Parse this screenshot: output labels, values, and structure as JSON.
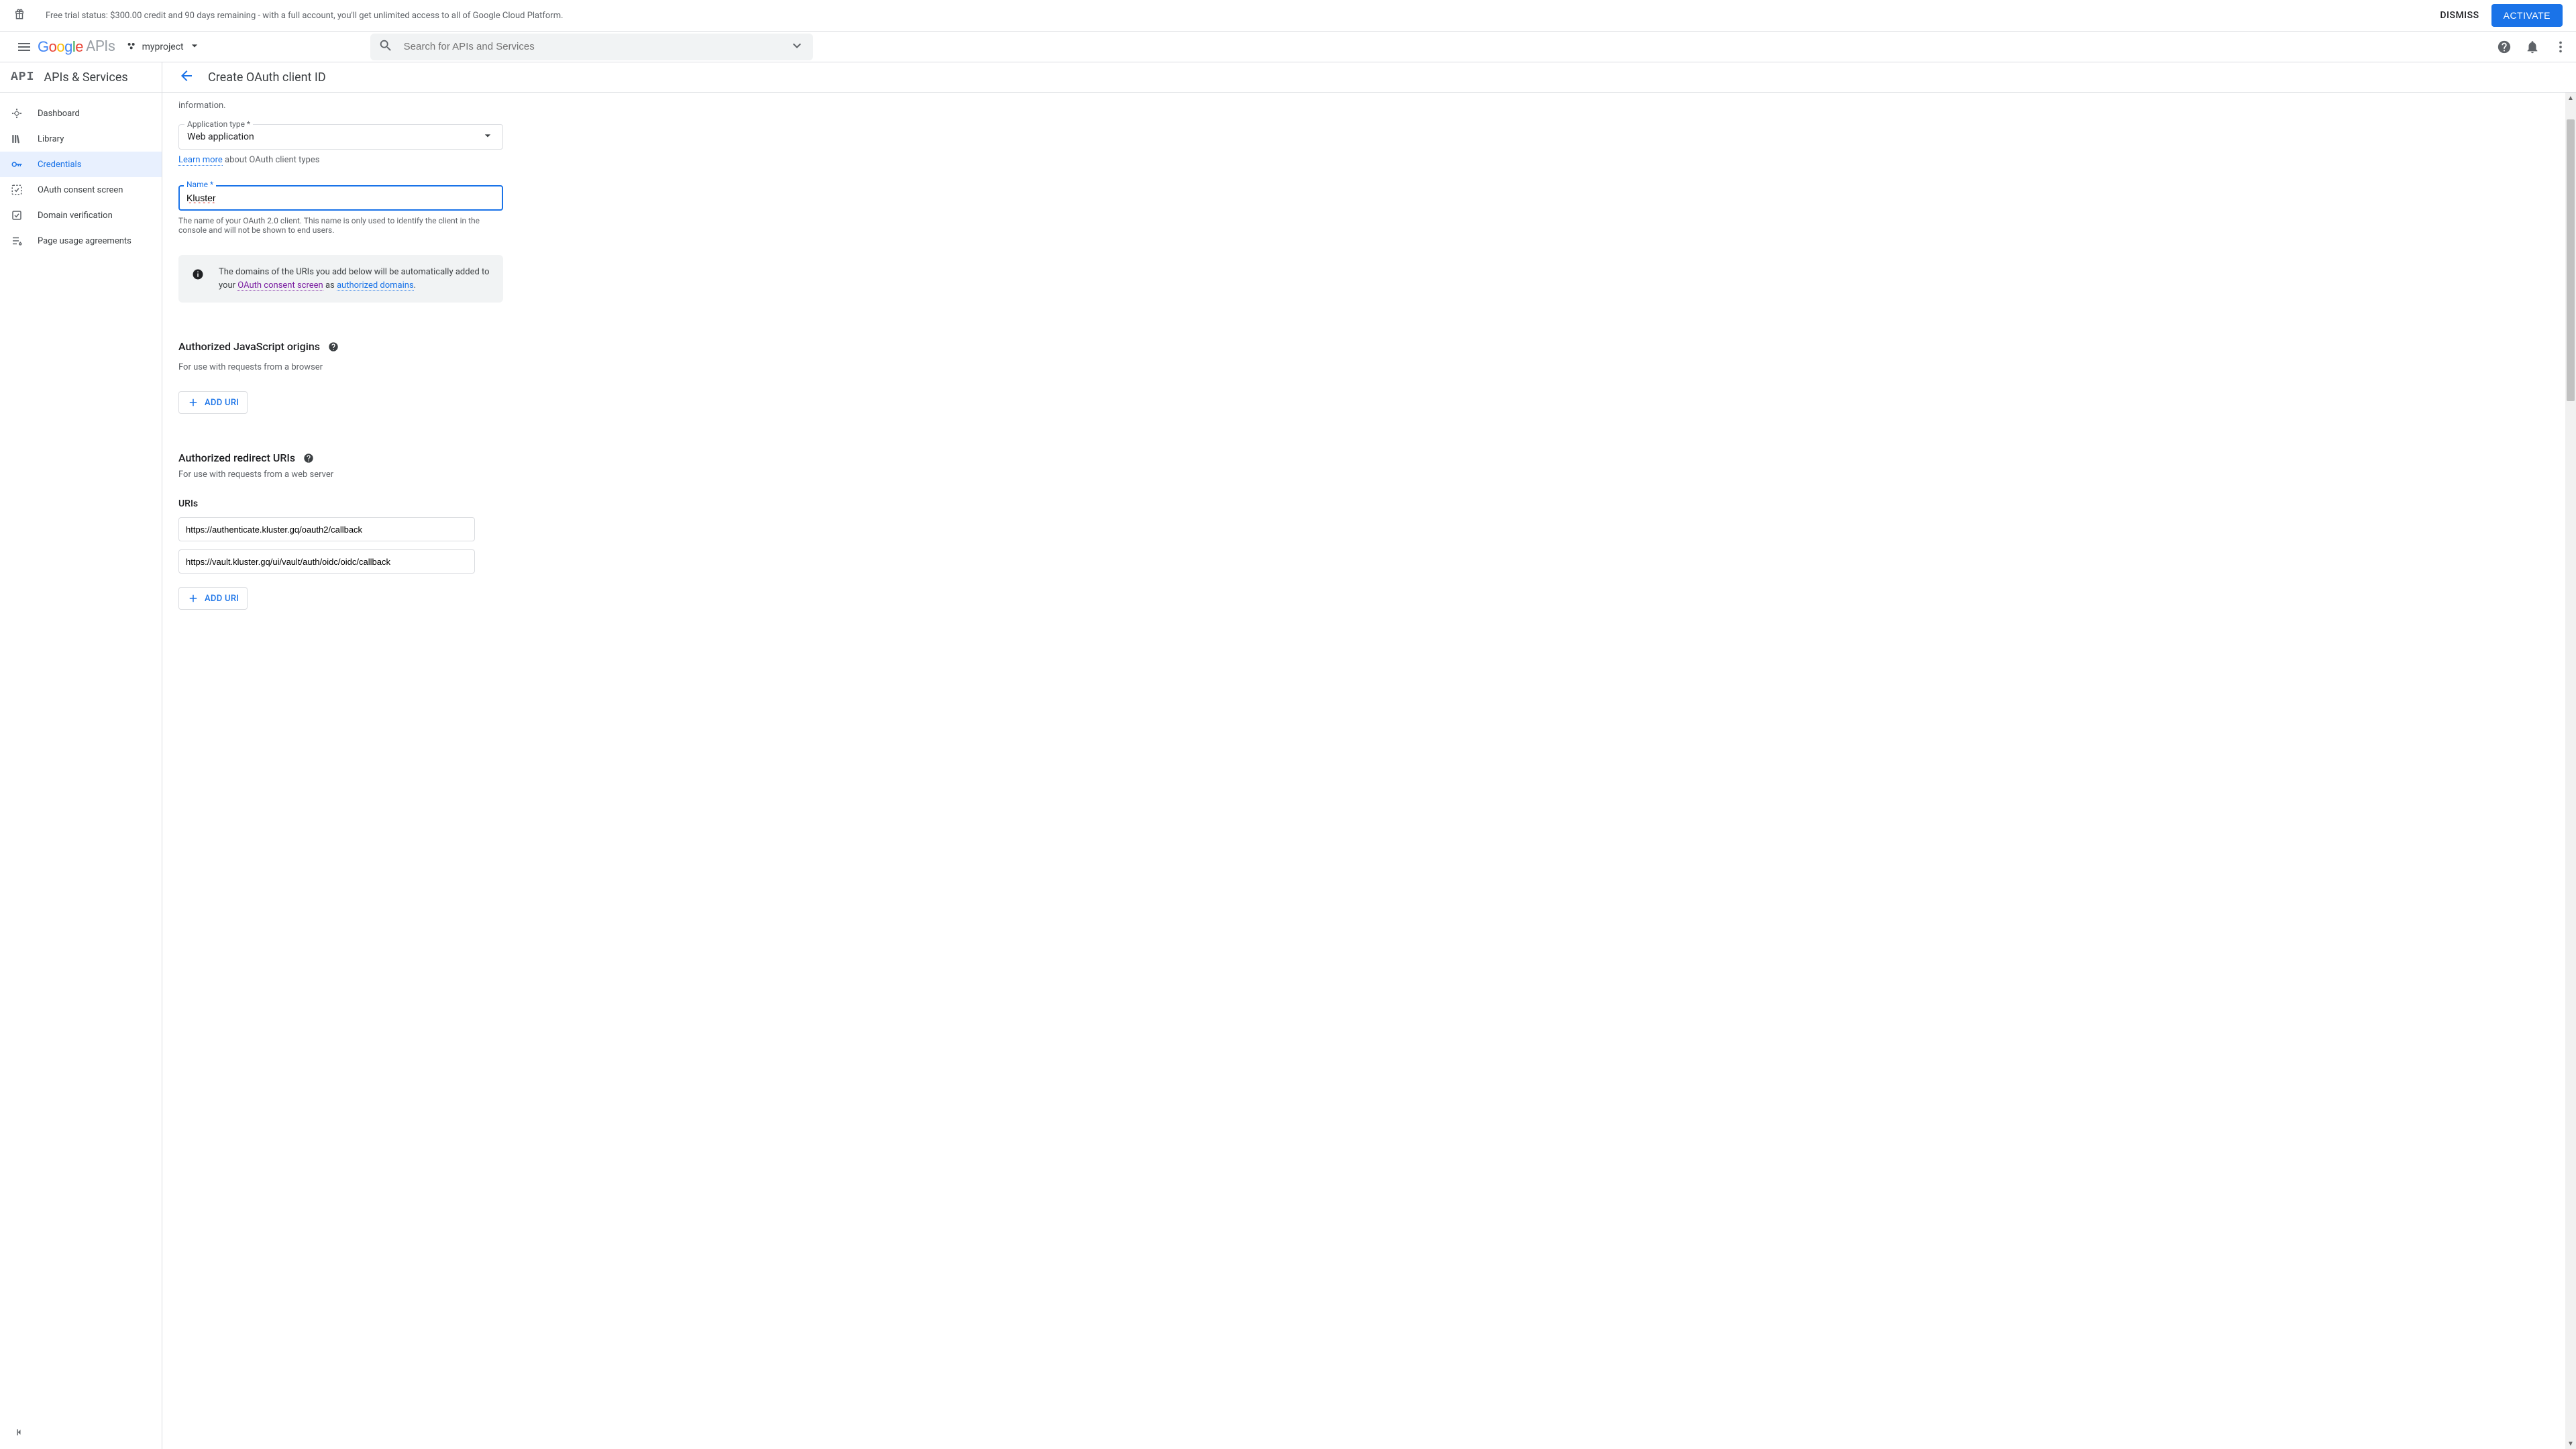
{
  "trial": {
    "text": "Free trial status: $300.00 credit and 90 days remaining - with a full account, you'll get unlimited access to all of Google Cloud Platform.",
    "dismiss": "DISMISS",
    "activate": "ACTIVATE"
  },
  "header": {
    "project_name": "myproject",
    "search_placeholder": "Search for APIs and Services"
  },
  "sidebar": {
    "section_title": "APIs & Services",
    "items": [
      {
        "label": "Dashboard"
      },
      {
        "label": "Library"
      },
      {
        "label": "Credentials"
      },
      {
        "label": "OAuth consent screen"
      },
      {
        "label": "Domain verification"
      },
      {
        "label": "Page usage agreements"
      }
    ]
  },
  "page": {
    "title": "Create OAuth client ID",
    "intro_tail": "information."
  },
  "form": {
    "app_type_label": "Application type *",
    "app_type_value": "Web application",
    "learn_more": "Learn more",
    "learn_more_tail": " about OAuth client types",
    "name_label": "Name *",
    "name_value": "Kluster",
    "name_helper": "The name of your OAuth 2.0 client. This name is only used to identify the client in the console and will not be shown to end users.",
    "info_pre": "The domains of the URIs you add below will be automatically added to your ",
    "info_link1": "OAuth consent screen",
    "info_mid": " as ",
    "info_link2": "authorized domains",
    "info_post": ".",
    "js_origins_title": "Authorized JavaScript origins",
    "js_origins_sub": "For use with requests from a browser",
    "add_uri": "ADD URI",
    "redirect_title": "Authorized redirect URIs",
    "redirect_sub": "For use with requests from a web server",
    "uris_label": "URIs",
    "uris": [
      "https://authenticate.kluster.gq/oauth2/callback",
      "https://vault.kluster.gq/ui/vault/auth/oidc/oidc/callback"
    ]
  }
}
